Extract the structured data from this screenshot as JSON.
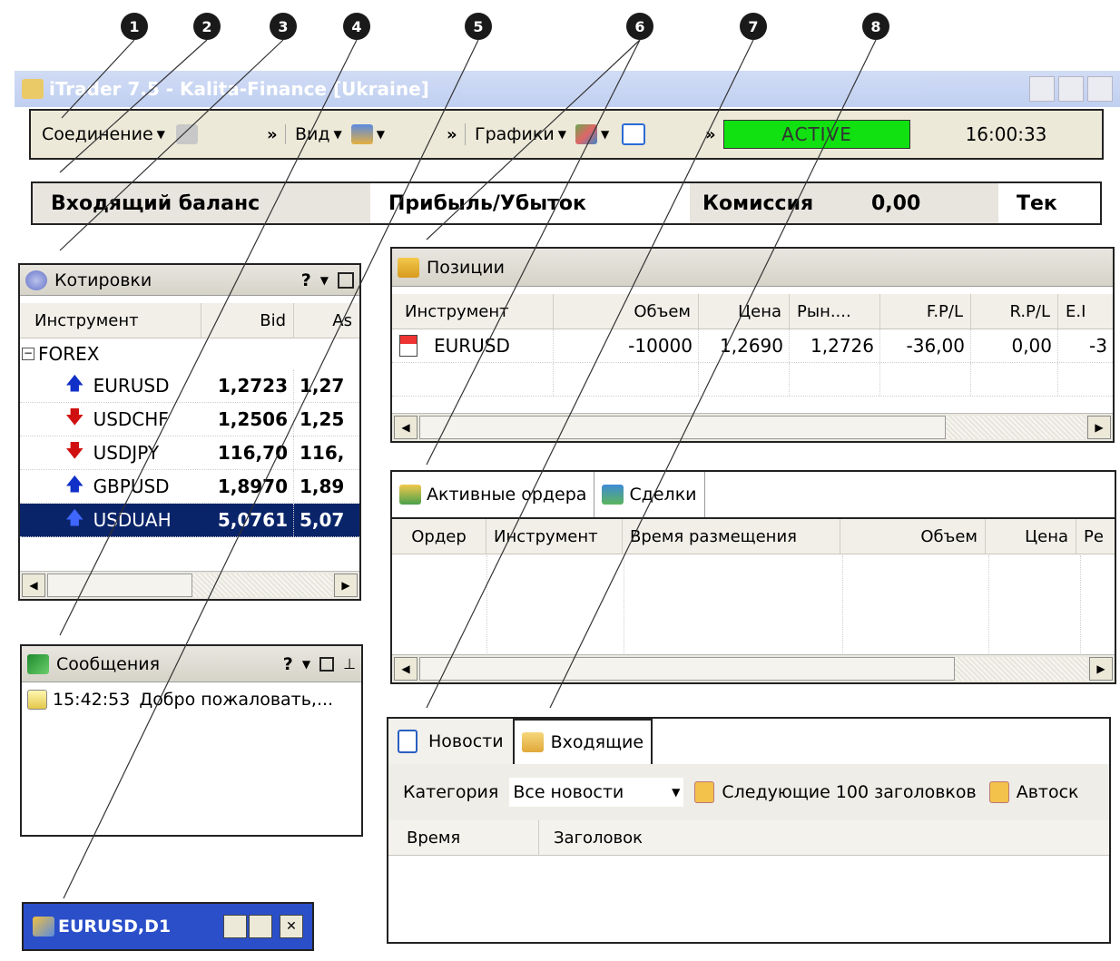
{
  "callouts": [
    "1",
    "2",
    "3",
    "4",
    "5",
    "6",
    "7",
    "8"
  ],
  "window": {
    "title": "iTrader 7.5 - Kalita-Finance [Ukraine]"
  },
  "toolbar": {
    "connection": "Соединение",
    "view": "Вид",
    "charts": "Графики",
    "chevron": "»",
    "status": "ACTIVE",
    "time": "16:00:33"
  },
  "balance_bar": {
    "incoming": "Входящий баланс",
    "pnl": "Прибыль/Убыток",
    "commission": "Комиссия",
    "commission_value": "0,00",
    "current": "Тек"
  },
  "quotes": {
    "title": "Котировки",
    "help": "?",
    "columns": [
      "Инструмент",
      "Bid",
      "As"
    ],
    "group": "FOREX",
    "rows": [
      {
        "symbol": "EURUSD",
        "bid": "1,2723",
        "ask": "1,27",
        "dir": "up"
      },
      {
        "symbol": "USDCHF",
        "bid": "1,2506",
        "ask": "1,25",
        "dir": "down"
      },
      {
        "symbol": "USDJPY",
        "bid": "116,70",
        "ask": "116,",
        "dir": "down"
      },
      {
        "symbol": "GBPUSD",
        "bid": "1,8970",
        "ask": "1,89",
        "dir": "up"
      },
      {
        "symbol": "USDUAH",
        "bid": "5,0761",
        "ask": "5,07",
        "dir": "up"
      }
    ]
  },
  "positions": {
    "title": "Позиции",
    "columns": [
      "Инструмент",
      "Объем",
      "Цена",
      "Рын....",
      "F.P/L",
      "R.P/L",
      "E.I"
    ],
    "row": {
      "symbol": "EURUSD",
      "volume": "-10000",
      "price": "1,2690",
      "market": "1,2726",
      "fpl": "-36,00",
      "rpl": "0,00",
      "epl": "-3"
    }
  },
  "orders": {
    "tab_active": "Активные ордера",
    "tab_deals": "Сделки",
    "columns": [
      "Ордер",
      "Инструмент",
      "Время размещения",
      "Объем",
      "Цена",
      "Ре"
    ]
  },
  "messages": {
    "title": "Сообщения",
    "help": "?",
    "time": "15:42:53",
    "text": "Добро пожаловать,..."
  },
  "news": {
    "tab_news": "Новости",
    "tab_inbox": "Входящие",
    "category_label": "Категория",
    "category_value": "Все новости",
    "next_label": "Следующие 100 заголовков",
    "auto_label": "Автоск",
    "columns": [
      "Время",
      "Заголовок"
    ]
  },
  "chart_window": {
    "title": "EURUSD,D1"
  },
  "colors": {
    "active_green": "#11e011",
    "selection": "#0a246a",
    "up_arrow": "#1030c8",
    "down_arrow": "#d01010"
  }
}
